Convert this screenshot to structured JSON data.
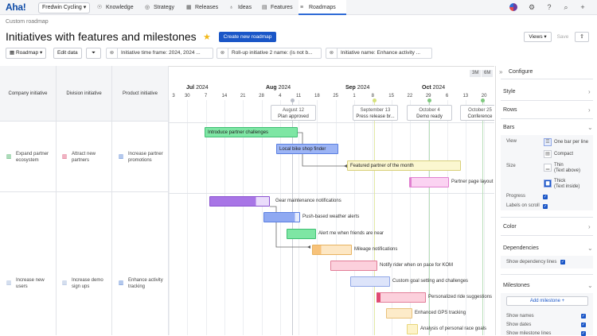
{
  "app": {
    "logo": "Aha!",
    "workspace": "Fredwin Cycling ▾"
  },
  "nav": [
    {
      "label": "Knowledge",
      "icon": "lightbulb-icon",
      "glyph": "☉"
    },
    {
      "label": "Strategy",
      "icon": "target-icon",
      "glyph": "◎"
    },
    {
      "label": "Releases",
      "icon": "calendar-icon",
      "glyph": "▦"
    },
    {
      "label": "Ideas",
      "icon": "idea-icon",
      "glyph": "♁"
    },
    {
      "label": "Features",
      "icon": "features-icon",
      "glyph": "▤"
    },
    {
      "label": "Roadmaps",
      "icon": "roadmap-icon",
      "glyph": "≡"
    }
  ],
  "header": {
    "breadcrumb": "Custom roadmap",
    "title": "Initiatives with features and milestones",
    "create_label": "Create new roadmap",
    "views_label": "Views ▾",
    "save_label": "Save",
    "share_glyph": "⇪"
  },
  "toolbar": {
    "roadmap_label": "Roadmap ▾",
    "edit_label": "Edit data",
    "filter_glyph": "⏷",
    "filters": [
      "Initiative time frame: 2024, 2024 ...",
      "Roll-up initiative 2 name: (is not b...",
      "Initiative name: Enhance activity ..."
    ]
  },
  "columns": [
    "Company initiative",
    "Division initiative",
    "Product initiative"
  ],
  "rows": [
    {
      "company": "Expand partner ecosystem",
      "division": "Attract new partners",
      "product": "Increase partner promotions",
      "company_color": "#3aa85a",
      "division_color": "#d9466b",
      "product_color": "#4a7bd1"
    },
    {
      "company": "Increase new users",
      "division": "Increase demo sign ups",
      "product": "Enhance activity tracking",
      "company_color": "#9ab1d8",
      "division_color": "#9ab1d8",
      "product_color": "#4a7bd1"
    }
  ],
  "timeline": {
    "zoom": [
      "3M",
      "6M",
      "1Y"
    ],
    "months": [
      {
        "name": "Jul",
        "year": "2024"
      },
      {
        "name": "Aug",
        "year": "2024"
      },
      {
        "name": "Sep",
        "year": "2024"
      },
      {
        "name": "Oct",
        "year": "2024"
      }
    ],
    "days": [
      "3",
      "30",
      "7",
      "14",
      "21",
      "28",
      "4",
      "11",
      "18",
      "25",
      "1",
      "8",
      "15",
      "22",
      "29",
      "6",
      "13",
      "20",
      "27"
    ],
    "milestones": [
      {
        "date": "August 12",
        "name": "Plan approved",
        "color": "#b9bec8"
      },
      {
        "date": "September 13",
        "name": "Press release br...",
        "color": "#d6e27a"
      },
      {
        "date": "October 4",
        "name": "Demo ready",
        "color": "#7fc97f"
      },
      {
        "date": "October 25",
        "name": "Conference",
        "color": "#7fc97f"
      }
    ],
    "features": [
      {
        "name": "Introduce partner challenges",
        "fill": "#7ee6a4",
        "border": "#3fbf73",
        "label_inside": true
      },
      {
        "name": "Local bike shop finder",
        "fill": "#9cb4f5",
        "border": "#5a7fe0",
        "label_inside": true
      },
      {
        "name": "Featured partner of the month",
        "fill": "#fbf7d0",
        "border": "#d8cf7a",
        "label_inside": true
      },
      {
        "name": "Partner page layout ...",
        "fill": "#fbd3f2",
        "border": "#e17fd0",
        "label_inside": false
      },
      {
        "name": "Gear maintenance notifications",
        "fill": "#a875e6",
        "border": "#8a52d0",
        "label_inside": false
      },
      {
        "name": "Push-based weather alerts",
        "fill": "#8fa9f2",
        "border": "#5a7fe0",
        "label_inside": false
      },
      {
        "name": "Alert me when friends are near",
        "fill": "#7ee6a4",
        "border": "#3fbf73",
        "label_inside": false
      },
      {
        "name": "Mileage notifications",
        "fill": "#fde7c4",
        "border": "#e8b360",
        "label_inside": false
      },
      {
        "name": "Notify rider when on pace for KOM",
        "fill": "#fcd0dc",
        "border": "#e27d98",
        "label_inside": false
      },
      {
        "name": "Custom goal setting and challenges",
        "fill": "#dde4fa",
        "border": "#8fa6e6",
        "label_inside": false
      },
      {
        "name": "Personalized ride suggestions",
        "fill": "#fcd0dc",
        "border": "#e04a72",
        "label_inside": false
      },
      {
        "name": "Enhanced GPS tracking",
        "fill": "#fdebc9",
        "border": "#e8c17a",
        "label_inside": false
      },
      {
        "name": "Analysis of personal race goals",
        "fill": "#fdf3c9",
        "border": "#e8d67a",
        "label_inside": false
      }
    ]
  },
  "panel": {
    "title": "Configure",
    "sections": {
      "style": "Style",
      "rows": "Rows",
      "bars": "Bars",
      "color": "Color",
      "dependencies": "Dependencies",
      "milestones": "Milestones"
    },
    "view_label": "View",
    "view_options": [
      "One bar per line",
      "Compact"
    ],
    "size_label": "Size",
    "size_options": [
      {
        "name": "Thin",
        "detail": "(Text above)"
      },
      {
        "name": "Thick",
        "detail": "(Text inside)"
      }
    ],
    "progress_label": "Progress",
    "labels_on_scroll": "Labels on scroll",
    "show_dependency_lines": "Show dependency lines",
    "add_milestone": "Add milestone +",
    "show_names": "Show names",
    "show_dates": "Show dates",
    "show_milestone_lines": "Show milestone lines"
  }
}
